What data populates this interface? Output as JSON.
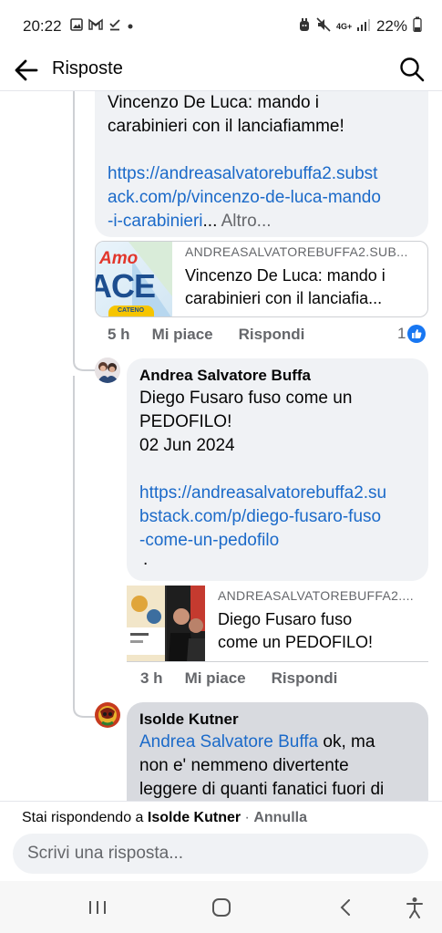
{
  "status_bar": {
    "time": "20:22",
    "network": "4G+",
    "battery": "22%",
    "icons": [
      "gallery-icon",
      "gmail-icon",
      "download-done-icon",
      "dot-icon",
      "alarm-icon",
      "mute-icon",
      "signal-icon",
      "battery-icon"
    ]
  },
  "header": {
    "title": "Risposte",
    "back_icon": "arrow-left-icon",
    "search_icon": "search-icon"
  },
  "comment_1": {
    "text_line_1": "Vincenzo De Luca: mando i",
    "text_line_2": "carabinieri con il lanciafiamme!",
    "link": "https://andreasalvatorebuffa2.substack.com/p/vincenzo-de-luca-mando-i-carabinieri",
    "link_line_1": "https://andreasalvatorebuffa2.subst",
    "link_line_2": "ack.com/p/vincenzo-de-luca-mando",
    "link_line_3": "-i-carabinieri",
    "ellipsis": "...",
    "more": "Altro...",
    "preview": {
      "domain": "ANDREASALVATOREBUFFA2.SUB...",
      "title_line_1": "Vincenzo De Luca: mando i",
      "title_line_2": "carabinieri con il lanciafia...",
      "thumb_text_1": "Amo",
      "thumb_text_2": "ACE",
      "thumb_text_3": "CATENO"
    },
    "time": "5 h",
    "like": "Mi piace",
    "reply": "Rispondi",
    "reaction_count": "1"
  },
  "comment_2": {
    "author": "Andrea Salvatore Buffa",
    "text_line_1": "Diego Fusaro fuso come un",
    "text_line_2": "PEDOFILO!",
    "text_line_3": "02 Jun 2024",
    "link_line_1": "https://andreasalvatorebuffa2.su",
    "link_line_2": "bstack.com/p/diego-fusaro-fuso",
    "link_line_3": "-come-un-pedofilo",
    "dot": ".",
    "preview": {
      "domain": "ANDREASALVATOREBUFFA2....",
      "title_line_1": "Diego Fusaro fuso",
      "title_line_2": "come un PEDOFILO!"
    },
    "time": "3 h",
    "like": "Mi piace",
    "reply": "Rispondi"
  },
  "comment_3": {
    "author": "Isolde Kutner",
    "mention": "Andrea Salvatore Buffa",
    "text_part_1": " ok, ma",
    "text_line_2": "non e' nemmeno divertente",
    "text_line_3": "leggere di quanti fanatici fuori di"
  },
  "reply_bar": {
    "status_prefix": "Stai rispondendo a ",
    "replying_to": "Isolde Kutner",
    "separator": " · ",
    "cancel": "Annulla",
    "placeholder": "Scrivi una risposta..."
  },
  "nav_bar": {
    "recents_icon": "recents-icon",
    "home_icon": "home-icon",
    "back_icon": "back-icon",
    "accessibility_icon": "accessibility-icon"
  },
  "colors": {
    "link": "#1b6ac9",
    "bubble": "#f0f2f5",
    "muted": "#65676b",
    "like_blue": "#1877f2"
  }
}
